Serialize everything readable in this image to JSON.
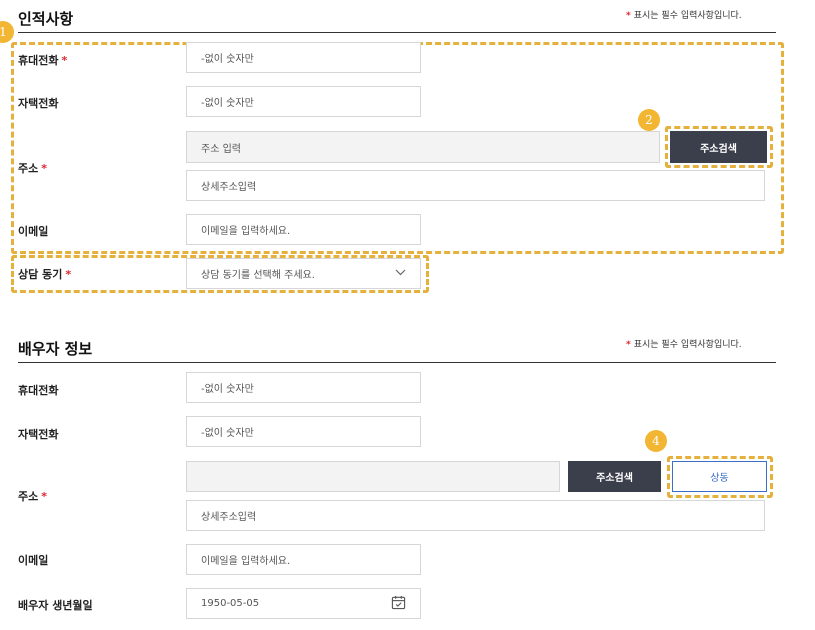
{
  "personal": {
    "title": "인적사항",
    "required_note": "표시는 필수 입력사항입니다.",
    "mobile_label": "휴대전화",
    "mobile_placeholder": "-없이 숫자만",
    "home_label": "자택전화",
    "home_placeholder": "-없이 숫자만",
    "address_label": "주소",
    "address_placeholder": "주소 입력",
    "address_search_button": "주소검색",
    "detail_address_placeholder": "상세주소입력",
    "email_label": "이메일",
    "email_placeholder": "이메일을 입력하세요.",
    "consent_label": "상담 동기",
    "consent_placeholder": "상담 동기를 선택해 주세요."
  },
  "spouse": {
    "title": "배우자 정보",
    "required_note": "표시는 필수 입력사항입니다.",
    "mobile_label": "휴대전화",
    "mobile_placeholder": "-없이 숫자만",
    "home_label": "자택전화",
    "home_placeholder": "-없이 숫자만",
    "address_label": "주소",
    "address_search_button": "주소검색",
    "same_button": "상동",
    "detail_address_placeholder": "상세주소입력",
    "email_label": "이메일",
    "email_placeholder": "이메일을 입력하세요.",
    "birth_label": "배우자 생년월일",
    "birth_value": "1950-05-05"
  },
  "badges": [
    "1",
    "2",
    "4"
  ],
  "colors": {
    "required_star": "#e0242c",
    "highlight_dash": "#e5b13c",
    "badge": "#f2b632",
    "dark_button": "#3b3f4b",
    "outline_button": "#3b6fc7"
  },
  "icons": {
    "select": "chevron-down-icon",
    "calendar": "calendar-icon"
  }
}
